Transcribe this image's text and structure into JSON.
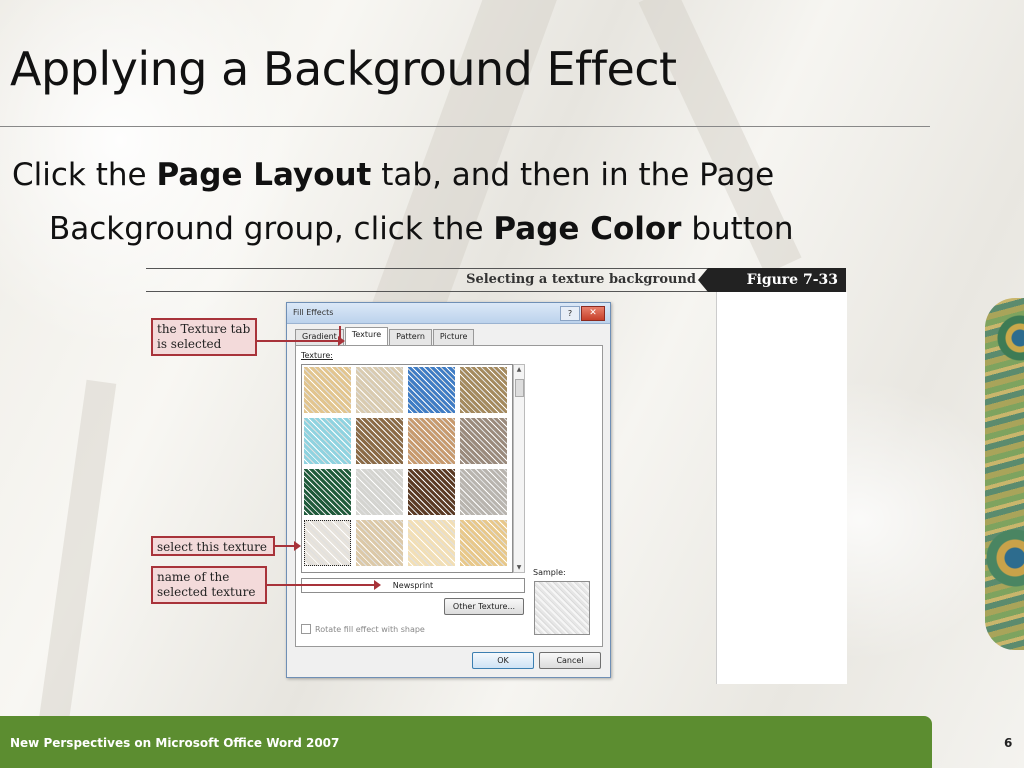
{
  "slide": {
    "title": "Applying a Background Effect",
    "body_prefix": "Click the ",
    "body_bold1": "Page Layout",
    "body_mid": " tab, and then in the Page",
    "body_line2_prefix": "Background group, click the ",
    "body_bold2": "Page Color",
    "body_suffix": " button"
  },
  "figure": {
    "caption": "Selecting a texture background",
    "label": "Figure  7-33"
  },
  "dialog": {
    "title": "Fill Effects",
    "help": "?",
    "close": "✕",
    "tabs": [
      "Gradient",
      "Texture",
      "Pattern",
      "Picture"
    ],
    "active_tab": "Texture",
    "texture_label": "Texture:",
    "selected_name": "Newsprint",
    "other_texture_button": "Other Texture...",
    "sample_label": "Sample:",
    "rotate_label": "Rotate fill effect with shape",
    "ok": "OK",
    "cancel": "Cancel",
    "textures": [
      "#e2c58f",
      "#d9cbb0",
      "#3f7cc4",
      "#a48a5e",
      "#8fd3e0",
      "#8a6a46",
      "#c79a6e",
      "#9a8a7c",
      "#1f5a3a",
      "#d4d4d0",
      "#5a3a24",
      "#b8b4ae",
      "#e7e3dc",
      "#dcc9a8",
      "#f2dfb6",
      "#e8c88a"
    ],
    "selected_texture_index": 12
  },
  "callouts": {
    "texture_tab": "the Texture tab is selected",
    "select_texture": "select this texture",
    "name_texture": "name of the selected texture"
  },
  "footer": {
    "left": "New Perspectives on Microsoft Office Word 2007",
    "page": "6"
  }
}
